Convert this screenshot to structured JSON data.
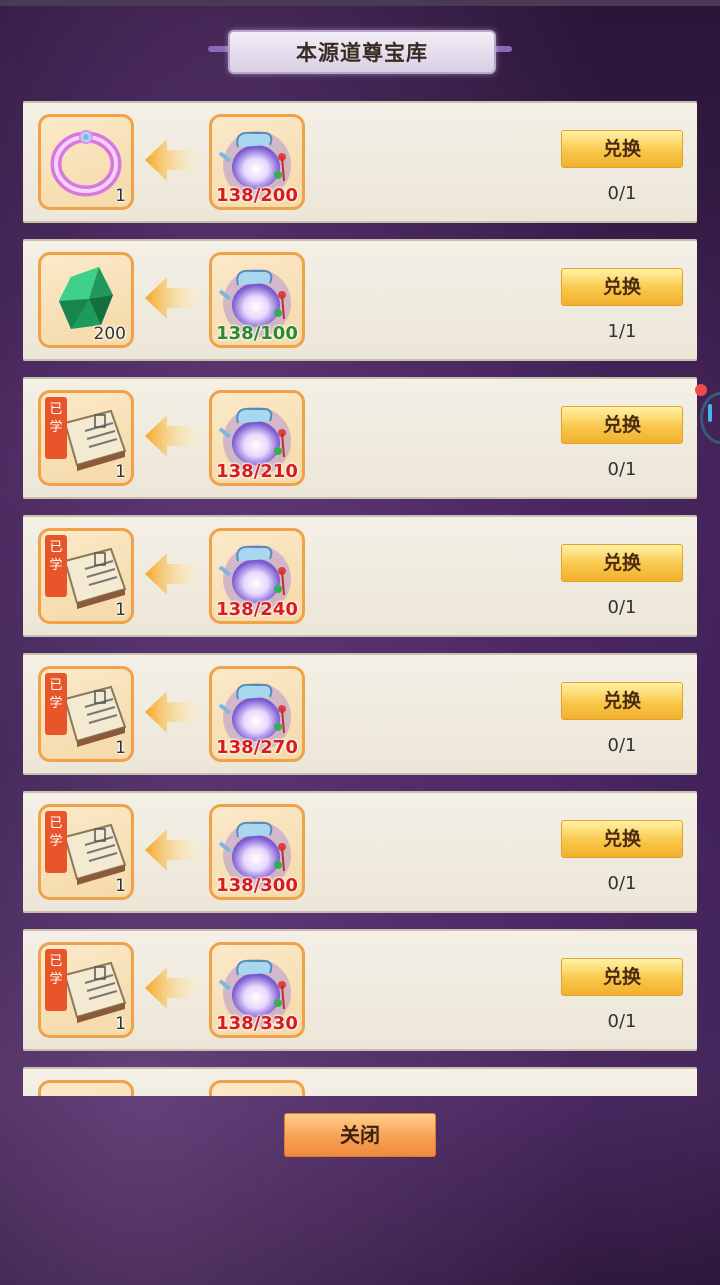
{
  "title": "本源道尊宝库",
  "exchange_label": "兑换",
  "close_label": "关闭",
  "learned_tag": "已学",
  "rows": [
    {
      "reward": "ring",
      "reward_qty": "1",
      "cost": "138/200",
      "cost_status": "insufficient",
      "progress": "0/1"
    },
    {
      "reward": "green-gem",
      "reward_qty": "200",
      "cost": "138/100",
      "cost_status": "sufficient",
      "progress": "1/1"
    },
    {
      "reward": "skill-book",
      "reward_qty": "1",
      "cost": "138/210",
      "cost_status": "insufficient",
      "progress": "0/1"
    },
    {
      "reward": "skill-book",
      "reward_qty": "1",
      "cost": "138/240",
      "cost_status": "insufficient",
      "progress": "0/1"
    },
    {
      "reward": "skill-book",
      "reward_qty": "1",
      "cost": "138/270",
      "cost_status": "insufficient",
      "progress": "0/1"
    },
    {
      "reward": "skill-book",
      "reward_qty": "1",
      "cost": "138/300",
      "cost_status": "insufficient",
      "progress": "0/1"
    },
    {
      "reward": "skill-book",
      "reward_qty": "1",
      "cost": "138/330",
      "cost_status": "insufficient",
      "progress": "0/1"
    }
  ],
  "colors": {
    "insufficient": "#d81c1c",
    "sufficient": "#2b8a2b",
    "button": "#f9c74a",
    "slot_border": "#f0a24a"
  }
}
